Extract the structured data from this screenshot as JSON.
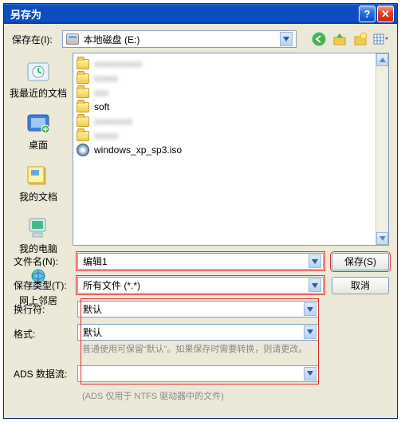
{
  "titlebar": {
    "title": "另存为",
    "help_icon": "?",
    "close_icon": "✕"
  },
  "topbar": {
    "label": "保存在(I):",
    "drive_text": "本地磁盘 (E:)",
    "nav_back": "←",
    "nav_up": "↑",
    "nav_new": "✧",
    "nav_view": "▦"
  },
  "places": [
    {
      "label": "我最近的文档",
      "icon": "recent"
    },
    {
      "label": "桌面",
      "icon": "desktop"
    },
    {
      "label": "我的文档",
      "icon": "mydocs"
    },
    {
      "label": "我的电脑",
      "icon": "mycomp"
    },
    {
      "label": "网上邻居",
      "icon": "network"
    }
  ],
  "files": [
    {
      "type": "folder",
      "name": "blurred"
    },
    {
      "type": "folder",
      "name": "blurred"
    },
    {
      "type": "folder",
      "name": "blurred"
    },
    {
      "type": "folder",
      "name": "soft"
    },
    {
      "type": "folder",
      "name": "blurred"
    },
    {
      "type": "folder",
      "name": "blurred"
    },
    {
      "type": "iso",
      "name": "windows_xp_sp3.iso"
    }
  ],
  "form": {
    "filename_label": "文件名(N):",
    "filename_value": "编辑1",
    "filetype_label": "保存类型(T):",
    "filetype_value": "所有文件 (*.*)",
    "linebreak_label": "换行符:",
    "linebreak_value": "默认",
    "format_label": "格式:",
    "format_value": "默认",
    "format_hint": "普通使用可保留“默认”。如果保存时需要转换，则请更改。",
    "ads_label": "ADS 数据流:",
    "ads_value": "",
    "ads_hint": "(ADS 仅用于 NTFS 驱动器中的文件)"
  },
  "buttons": {
    "save": "保存(S)",
    "cancel": "取消"
  }
}
